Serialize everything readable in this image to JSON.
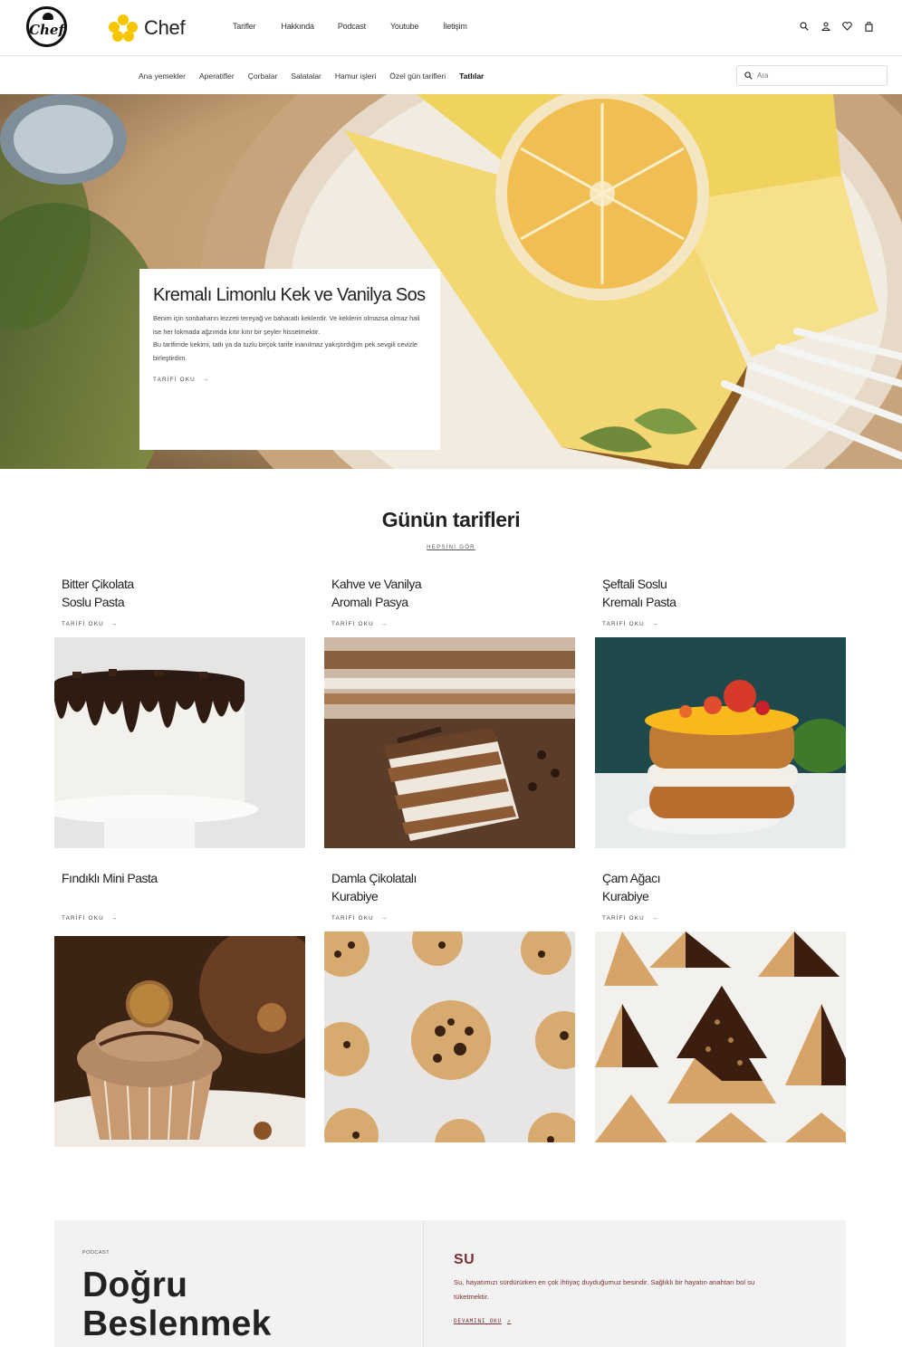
{
  "header": {
    "logo_text": "Chef",
    "brand_name": "Chef",
    "nav": [
      "Tarifler",
      "Hakkında",
      "Podcast",
      "Youtube",
      "İletişim"
    ],
    "icons": [
      "search-icon",
      "user-icon",
      "heart-icon",
      "bag-icon"
    ]
  },
  "categories": {
    "items": [
      "Ana yemekler",
      "Aperatifler",
      "Çorbalar",
      "Salatalar",
      "Hamur işleri",
      "Özel gün tarifleri",
      "Tatlılar"
    ],
    "active": "Tatlılar"
  },
  "search": {
    "placeholder": "Ara"
  },
  "hero": {
    "title": "Kremalı Limonlu Kek ve Vanilya Sos",
    "text": "Benim için sonbaharın lezzeti tereyağ ve baharatlı keklerdir. Ve keklerin olmazsa olmaz hali ise her lokmada ağzımda kıtır kıtır bir şeyler hissetmektir.\nBu tarifimde kekimi, tatlı ya da tuzlu birçok tarife inanılmaz yakıştırdığım pek sevgili cevizle birleştirdim.",
    "link": "TARİFİ OKU",
    "link_arrow": "→"
  },
  "recipes": {
    "title": "Günün tarifleri",
    "see_all": "HEPSİNİ GÖR",
    "link": "TARİFİ OKU",
    "link_arrow": "→",
    "items": [
      {
        "title": "Bitter Çikolata\nSoslu Pasta"
      },
      {
        "title": "Kahve ve Vanilya\nAromalı Pasya"
      },
      {
        "title": "Şeftali Soslu\nKremalı Pasta"
      },
      {
        "title": "Fındıklı Mini Pasta"
      },
      {
        "title": "Damla Çikolatalı\nKurabiye"
      },
      {
        "title": "Çam Ağacı\nKurabiye"
      }
    ]
  },
  "podcast": {
    "tag": "PODCAST",
    "title": "Doğru\nBeslenmek",
    "episode_title": "SU",
    "episode_text": "Su, hayatımızı sürdürürken en çok ihtiyaç duyduğumuz besindir. Sağlıklı bir hayatın anahtarı bol su tüketmektir.",
    "link": "DEVAMINI OKU",
    "link_arrow": "↗"
  },
  "colors": {
    "accent": "#7a2f33",
    "brand_yellow": "#f7c600",
    "panel": "#f2f2f2"
  }
}
